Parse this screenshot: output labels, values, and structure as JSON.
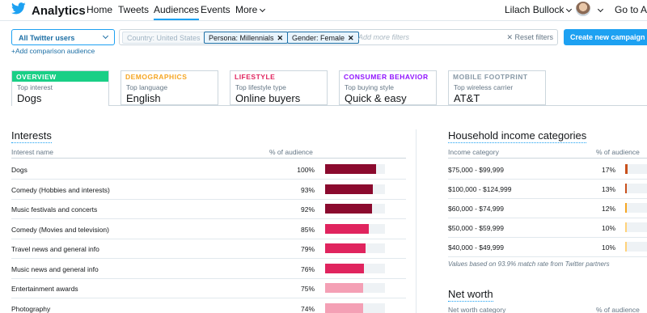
{
  "header": {
    "brand": "Analytics",
    "nav": [
      {
        "label": "Home"
      },
      {
        "label": "Tweets"
      },
      {
        "label": "Audiences"
      },
      {
        "label": "Events"
      },
      {
        "label": "More"
      }
    ],
    "user_name": "Lilach Bullock",
    "goto": "Go to Ads"
  },
  "filters": {
    "audience_select": "All Twitter users",
    "chips": [
      {
        "label": "Country: United States",
        "removable": false
      },
      {
        "label": "Persona: Millennials",
        "removable": true
      },
      {
        "label": "Gender: Female",
        "removable": true
      }
    ],
    "placeholder": "Add more filters",
    "reset_label": "Reset filters",
    "create_label": "Create new campaign",
    "add_comparison": "+Add comparison audience"
  },
  "tabs": [
    {
      "head": "OVERVIEW",
      "sub": "Top interest",
      "value": "Dogs",
      "color": "#19cf86"
    },
    {
      "head": "DEMOGRAPHICS",
      "sub": "Top language",
      "value": "English",
      "color": "#f5a623"
    },
    {
      "head": "LIFESTYLE",
      "sub": "Top lifestyle type",
      "value": "Online buyers",
      "color": "#e0245e"
    },
    {
      "head": "CONSUMER BEHAVIOR",
      "sub": "Top buying style",
      "value": "Quick & easy",
      "color": "#9013fe"
    },
    {
      "head": "MOBILE FOOTPRINT",
      "sub": "Top wireless carrier",
      "value": "AT&T",
      "color": "#8899a6"
    }
  ],
  "interests": {
    "title": "Interests",
    "col_name": "Interest name",
    "col_pct": "% of audience",
    "rows": [
      {
        "name": "Dogs",
        "pct": "100%",
        "value": 100,
        "color": "#8b0a2e"
      },
      {
        "name": "Comedy (Hobbies and interests)",
        "pct": "93%",
        "value": 93,
        "color": "#8b0a2e"
      },
      {
        "name": "Music festivals and concerts",
        "pct": "92%",
        "value": 92,
        "color": "#8b0a2e"
      },
      {
        "name": "Comedy (Movies and television)",
        "pct": "85%",
        "value": 85,
        "color": "#e0245e"
      },
      {
        "name": "Travel news and general info",
        "pct": "79%",
        "value": 79,
        "color": "#e0245e"
      },
      {
        "name": "Music news and general info",
        "pct": "76%",
        "value": 76,
        "color": "#e0245e"
      },
      {
        "name": "Entertainment awards",
        "pct": "75%",
        "value": 75,
        "color": "#f4a0b5"
      },
      {
        "name": "Photography",
        "pct": "74%",
        "value": 74,
        "color": "#f4a0b5"
      }
    ]
  },
  "income": {
    "title": "Household income categories",
    "col_name": "Income category",
    "col_pct": "% of audience",
    "rows": [
      {
        "name": "$75,000 - $99,999",
        "pct": "17%",
        "value": 17,
        "color": "#c9501c"
      },
      {
        "name": "$100,000 - $124,999",
        "pct": "13%",
        "value": 13,
        "color": "#c9501c"
      },
      {
        "name": "$60,000 - $74,999",
        "pct": "12%",
        "value": 12,
        "color": "#f5a623"
      },
      {
        "name": "$50,000 - $59,999",
        "pct": "10%",
        "value": 10,
        "color": "#ffd27a"
      },
      {
        "name": "$40,000 - $49,999",
        "pct": "10%",
        "value": 10,
        "color": "#ffd27a"
      }
    ],
    "note": "Values based on 93.9% match rate from Twitter partners"
  },
  "networth": {
    "title": "Net worth",
    "col_name": "Net worth category",
    "col_pct": "% of audience"
  }
}
